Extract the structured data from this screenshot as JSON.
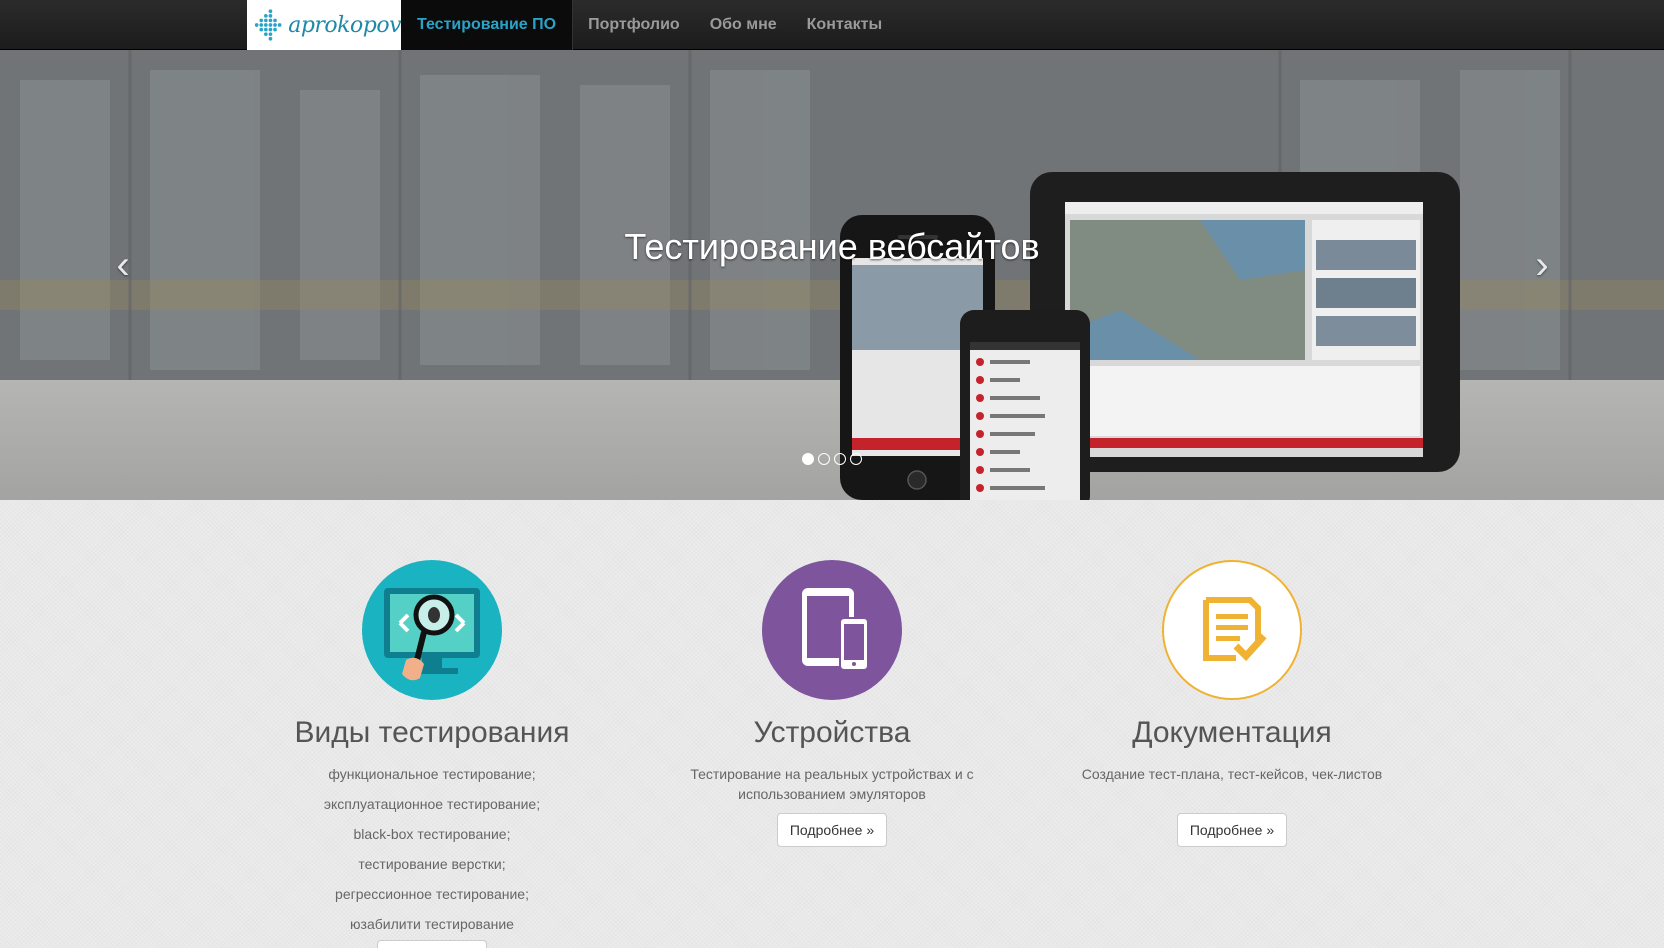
{
  "brand": {
    "name": "aprokopov"
  },
  "nav": {
    "items": [
      {
        "label": "Тестирование ПО",
        "active": true
      },
      {
        "label": "Портфолио"
      },
      {
        "label": "Обо мне"
      },
      {
        "label": "Контакты"
      }
    ]
  },
  "carousel": {
    "caption": "Тестирование вебсайтов",
    "prev_icon": "chevron-left-icon",
    "next_icon": "chevron-right-icon",
    "slide_count": 4,
    "active_slide": 1
  },
  "features": [
    {
      "title": "Виды тестирования",
      "icon": "magnifier-bug-icon",
      "list": [
        "функциональное тестирование;",
        "эксплуатационное тестирование;",
        "black-box тестирование;",
        "тестирование верстки;",
        "регрессионное тестирование;",
        "юзабилити тестирование"
      ],
      "color": "#1ab3c1"
    },
    {
      "title": "Устройства",
      "icon": "devices-icon",
      "description": "Тестирование на реальных устройствах и с использованием эмуляторов",
      "button": "Подробнее »",
      "color": "#7e559d"
    },
    {
      "title": "Документация",
      "icon": "document-check-icon",
      "description": "Создание тест-плана, тест-кейсов, чек-листов",
      "button": "Подробнее »",
      "color": "#f0b232"
    }
  ]
}
